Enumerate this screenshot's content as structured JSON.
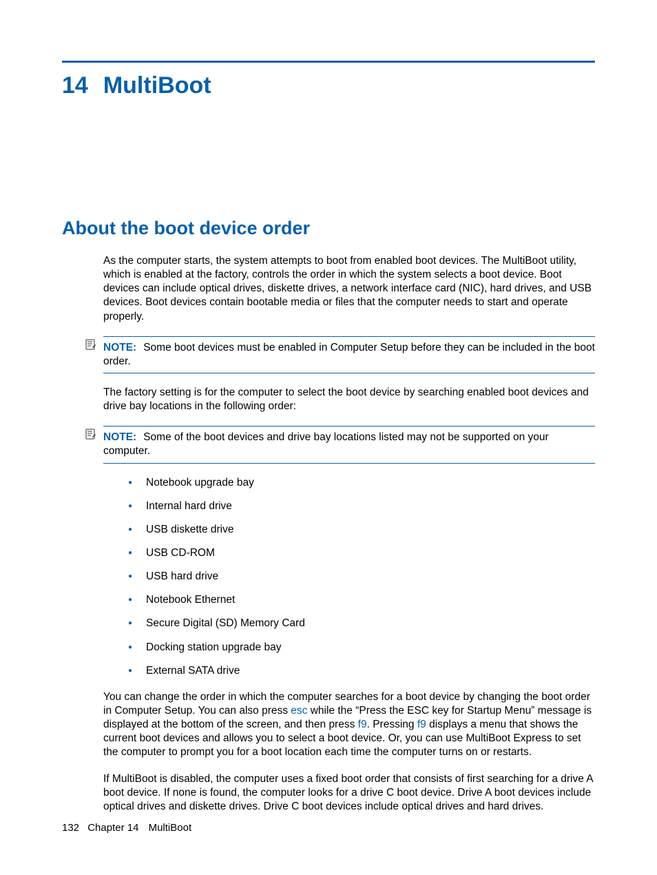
{
  "chapter": {
    "number": "14",
    "title": "MultiBoot"
  },
  "section": {
    "heading": "About the boot device order"
  },
  "para1": "As the computer starts, the system attempts to boot from enabled boot devices. The MultiBoot utility, which is enabled at the factory, controls the order in which the system selects a boot device. Boot devices can include optical drives, diskette drives, a network interface card (NIC), hard drives, and USB devices. Boot devices contain bootable media or files that the computer needs to start and operate properly.",
  "note1": {
    "label": "NOTE:",
    "text": "Some boot devices must be enabled in Computer Setup before they can be included in the boot order."
  },
  "para2": "The factory setting is for the computer to select the boot device by searching enabled boot devices and drive bay locations in the following order:",
  "note2": {
    "label": "NOTE:",
    "text": "Some of the boot devices and drive bay locations listed may not be supported on your computer."
  },
  "list": [
    "Notebook upgrade bay",
    "Internal hard drive",
    "USB diskette drive",
    "USB CD-ROM",
    "USB hard drive",
    "Notebook Ethernet",
    "Secure Digital (SD) Memory Card",
    "Docking station upgrade bay",
    "External SATA drive"
  ],
  "para3": {
    "seg1": "You can change the order in which the computer searches for a boot device by changing the boot order in Computer Setup. You can also press ",
    "key1": "esc",
    "seg2": " while the “Press the ESC key for Startup Menu” message is displayed at the bottom of the screen, and then press ",
    "key2": "f9",
    "seg3": ". Pressing ",
    "key3": "f9",
    "seg4": " displays a menu that shows the current boot devices and allows you to select a boot device. Or, you can use MultiBoot Express to set the computer to prompt you for a boot location each time the computer turns on or restarts."
  },
  "para4": "If MultiBoot is disabled, the computer uses a fixed boot order that consists of first searching for a drive A boot device. If none is found, the computer looks for a drive C boot device. Drive A boot devices include optical drives and diskette drives. Drive C boot devices include optical drives and hard drives.",
  "footer": {
    "page": "132",
    "chapter_label": "Chapter 14",
    "chapter_title": "MultiBoot"
  }
}
